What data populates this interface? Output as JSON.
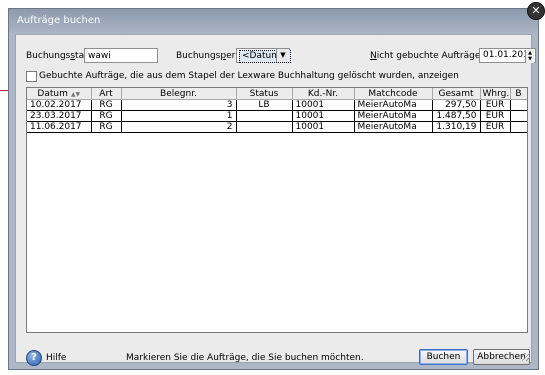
{
  "window": {
    "title": "Aufträge buchen",
    "close_glyph": "✕"
  },
  "form": {
    "stapel_pre": "Buchungs",
    "stapel_key": "s",
    "stapel_post": "tapel",
    "stapel_value": "wawi",
    "periode_pre": "Buchungs",
    "periode_key": "p",
    "periode_post": "eriode",
    "periode_value": "<Datum>",
    "nicht_key": "N",
    "nicht_post": "icht gebuchte Aufträge ab dem",
    "ab_date": "01.01.2017",
    "checkbox_label": "Gebuchte Aufträge, die aus dem Stapel der Lexware Buchhaltung gelöscht wurden, anzeigen",
    "checkbox_checked": false
  },
  "table": {
    "columns": [
      "Datum",
      "Art",
      "Belegnr.",
      "Status",
      "Kd.-Nr.",
      "Matchcode",
      "Gesamt",
      "Whrg.",
      "B"
    ],
    "rows": [
      [
        "10.02.2017",
        "RG",
        "3",
        "LB",
        "10001",
        "MeierAutoMa",
        "297,50",
        "EUR",
        ""
      ],
      [
        "23.03.2017",
        "RG",
        "1",
        "",
        "10001",
        "MeierAutoMa",
        "1.487,50",
        "EUR",
        ""
      ],
      [
        "11.06.2017",
        "RG",
        "2",
        "",
        "10001",
        "MeierAutoMa",
        "1.310,19",
        "EUR",
        ""
      ]
    ]
  },
  "footer": {
    "help_label": "Hilfe",
    "help_icon": "?",
    "status_text": "Markieren Sie die Aufträge, die Sie buchen möchten.",
    "buchen_label": "Buchen",
    "abbrechen_label": "Abbrechen"
  },
  "colors": {
    "titlebar": "#97a3b6",
    "dialog_bg": "#ebebeb",
    "accent": "#3b6fc4",
    "marker": "#b3263a"
  }
}
